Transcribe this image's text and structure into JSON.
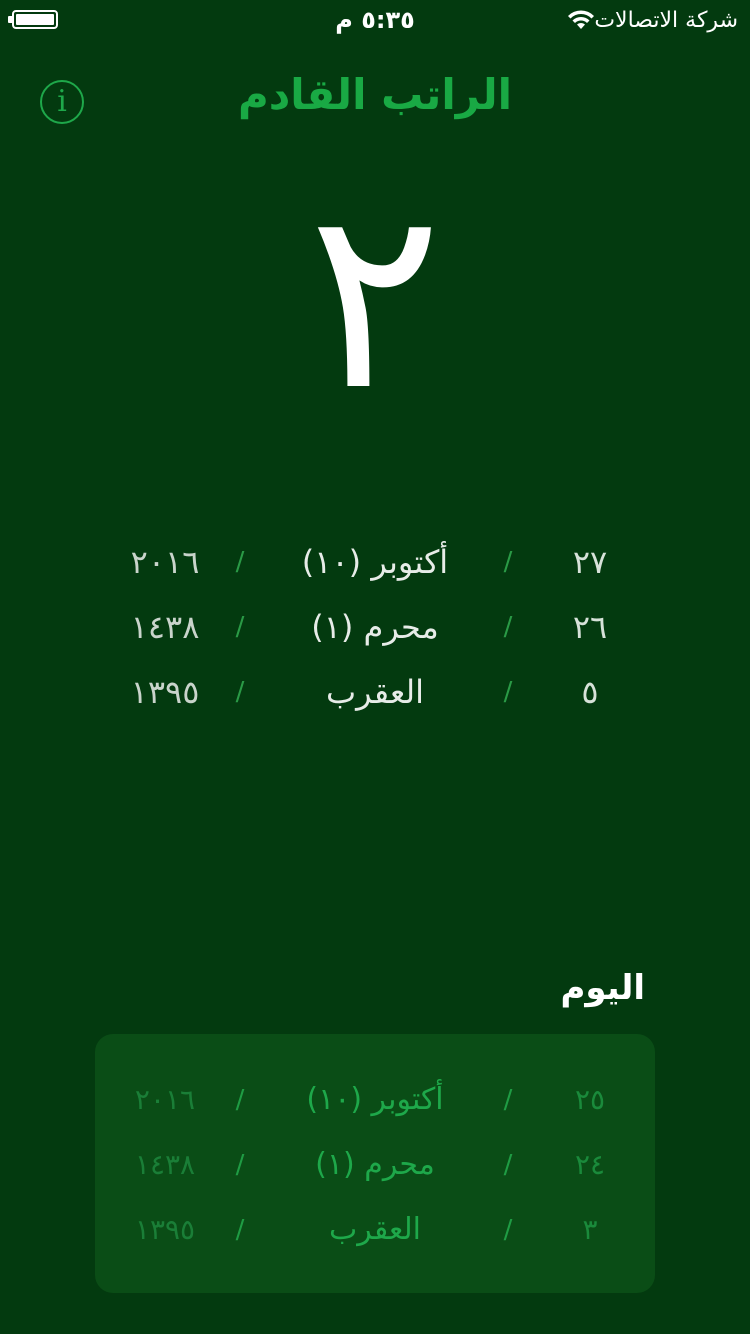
{
  "status_bar": {
    "carrier": "شركة الاتصالات",
    "time": "٥:٣٥ م"
  },
  "header": {
    "title": "الراتب القادم",
    "info_glyph": "i"
  },
  "countdown": {
    "days": "٢"
  },
  "next_payday": {
    "rows": [
      {
        "day": "٢٧",
        "month": "أكتوبر (١٠)",
        "year": "٢٠١٦"
      },
      {
        "day": "٢٦",
        "month": "محرم (١)",
        "year": "١٤٣٨"
      },
      {
        "day": "٥",
        "month": "العقرب",
        "year": "١٣٩٥"
      }
    ],
    "separator": "/"
  },
  "today": {
    "label": "اليوم",
    "rows": [
      {
        "day": "٢٥",
        "month": "أكتوبر (١٠)",
        "year": "٢٠١٦"
      },
      {
        "day": "٢٤",
        "month": "محرم (١)",
        "year": "١٤٣٨"
      },
      {
        "day": "٣",
        "month": "العقرب",
        "year": "١٣٩٥"
      }
    ],
    "separator": "/"
  },
  "colors": {
    "background": "#033a0f",
    "accent": "#19a944",
    "card": "#0a4d16"
  },
  "icons": [
    "battery-icon",
    "wifi-icon",
    "info-icon"
  ]
}
